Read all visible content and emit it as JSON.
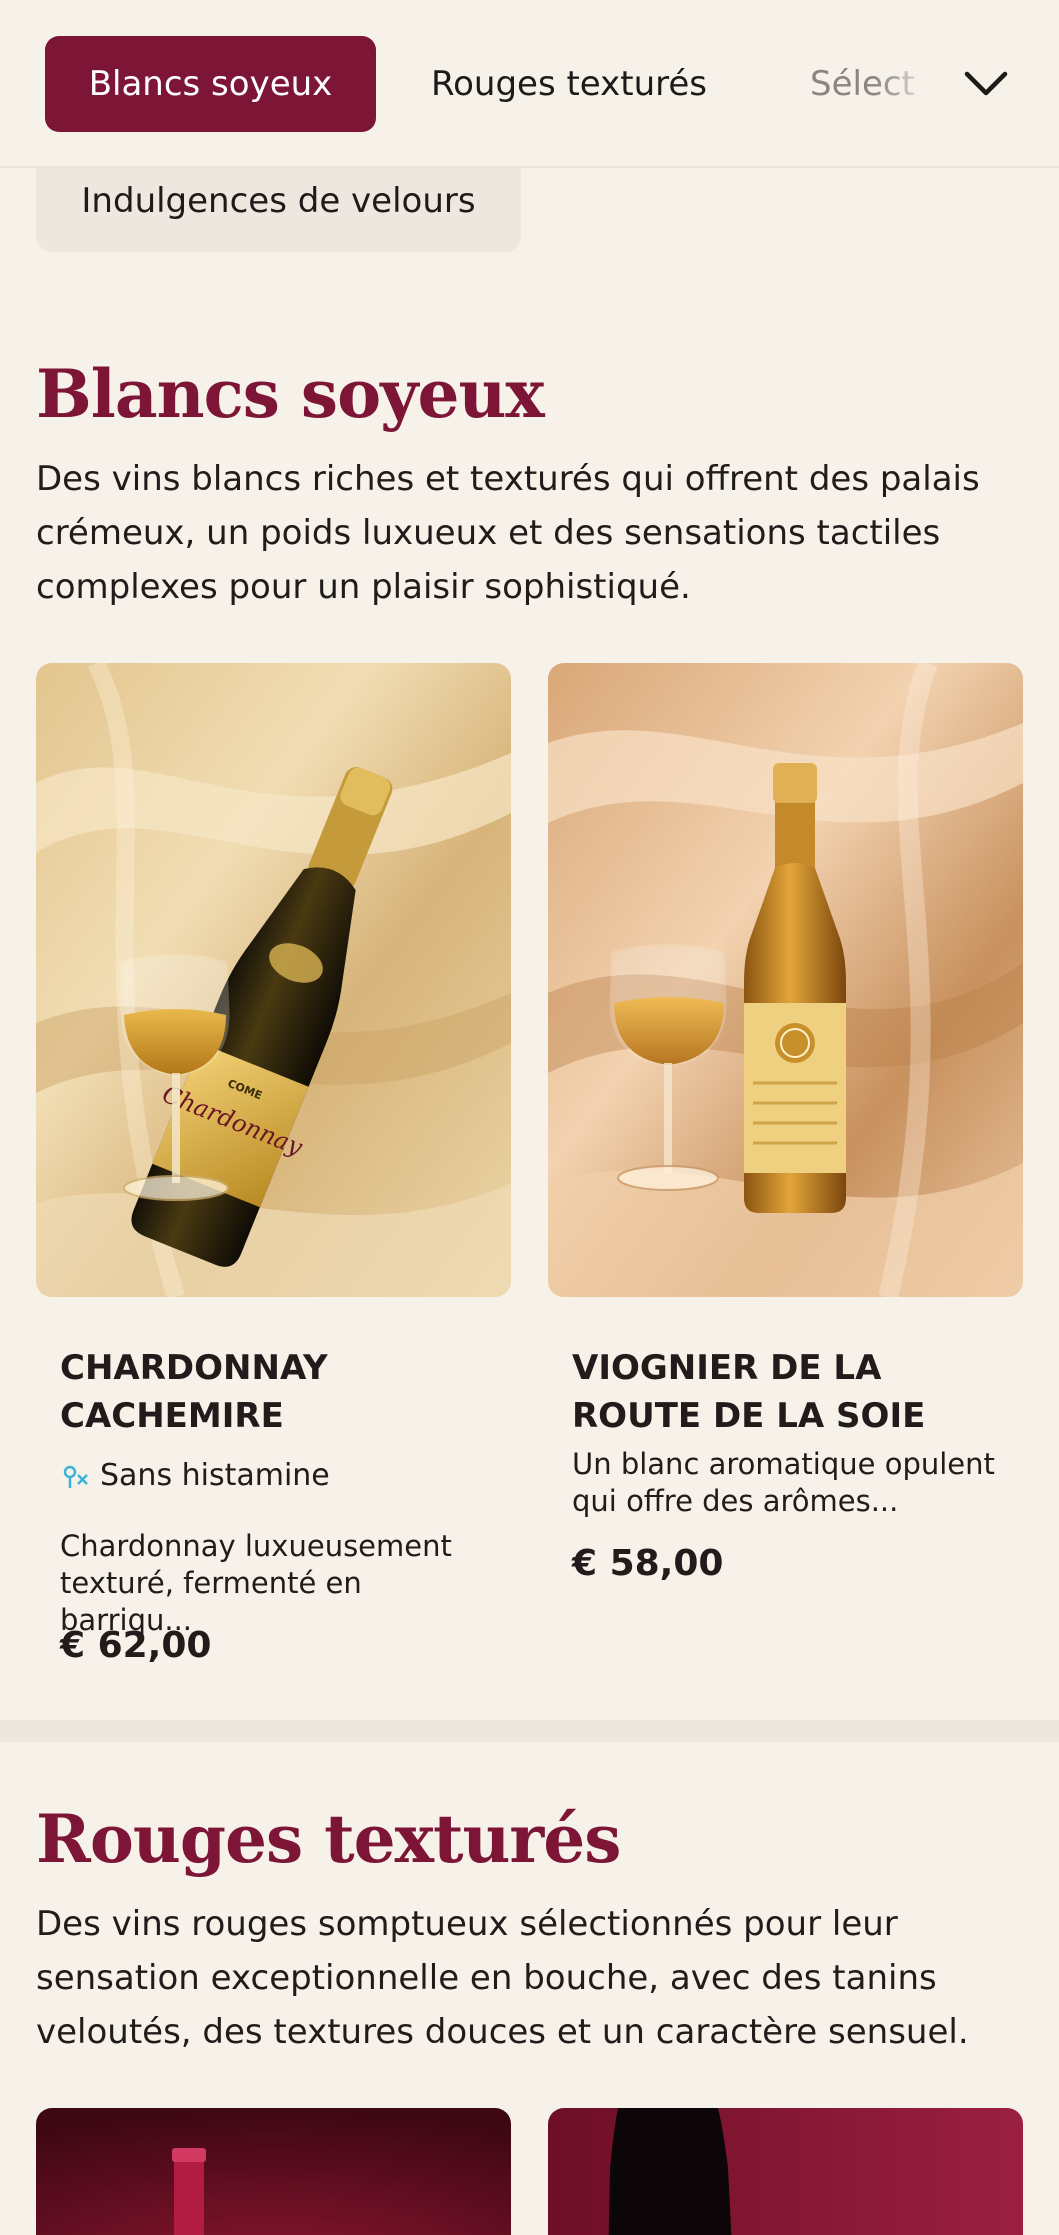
{
  "category_nav": {
    "tabs": [
      {
        "label": "Blancs soyeux",
        "active": true
      },
      {
        "label": "Rouges texturés",
        "active": false
      },
      {
        "label": "Sélect",
        "active": false
      }
    ],
    "overflow_tab": {
      "label": "Indulgences de velours"
    },
    "toggle_icon": "chevron-down-icon"
  },
  "sections": [
    {
      "title": "Blancs soyeux",
      "description": "Des vins blancs riches et texturés qui offrent des palais crémeux, un poids luxueux et des sensations tactiles complexes pour un plaisir sophistiqué.",
      "products": [
        {
          "name": "CHARDONNAY CACHEMIRE",
          "badge": {
            "icon": "histamine-free-icon",
            "label": "Sans histamine"
          },
          "description": "Chardonnay luxueusement texturé, fermenté en barriqu...",
          "price": "€ 62,00",
          "image": "chardonnay-bottle-glass-on-satin",
          "bottle_label": {
            "brand": "COME",
            "varietal": "Chardonnay"
          }
        },
        {
          "name": "VIOGNIER DE LA ROUTE DE LA SOIE",
          "description": "Un blanc aromatique opulent qui offre des arômes...",
          "price": "€ 58,00",
          "image": "viognier-bottle-glass-on-satin"
        }
      ]
    },
    {
      "title": "Rouges texturés",
      "description": "Des vins rouges somptueux sélectionnés pour leur sensation exceptionnelle en bouche, avec des tanins veloutés, des textures douces et un caractère sensuel.",
      "products": [
        {
          "image": "red-wine-bottle-burgundy"
        },
        {
          "image": "red-wine-bottle-dark"
        }
      ]
    }
  ],
  "colors": {
    "accent": "#7c1536",
    "background": "#f6f1e9",
    "text": "#221b1b",
    "badge_icon": "#3bb3d9"
  }
}
